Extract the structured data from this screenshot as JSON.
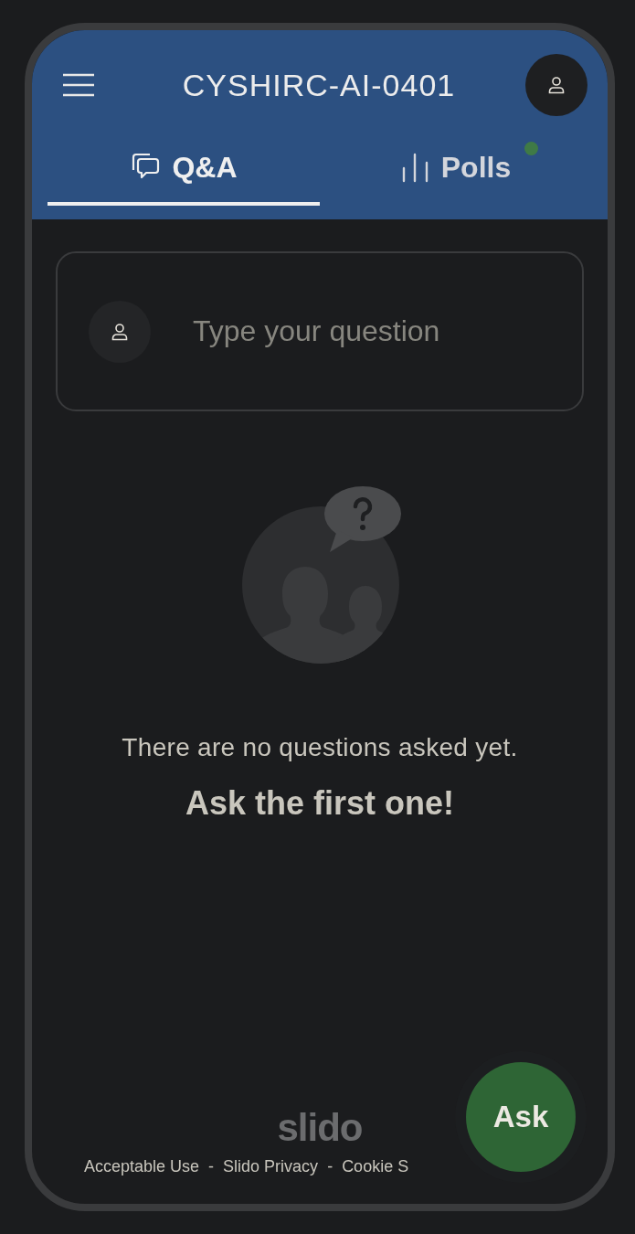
{
  "header": {
    "title": "CYSHIRC-AI-0401"
  },
  "tabs": [
    {
      "label": "Q&A",
      "kind": "qa",
      "selected": true,
      "has_update": false
    },
    {
      "label": "Polls",
      "kind": "polls",
      "selected": false,
      "has_update": true
    }
  ],
  "question_field": {
    "placeholder": "Type your question"
  },
  "empty_state": {
    "message": "There are no questions asked yet.",
    "call_to_action": "Ask the first one!"
  },
  "footer": {
    "logo": "slido",
    "links": [
      "Acceptable Use",
      "Slido Privacy",
      "Cookie S"
    ],
    "separator": "-"
  },
  "ask_button": {
    "label": "Ask"
  }
}
